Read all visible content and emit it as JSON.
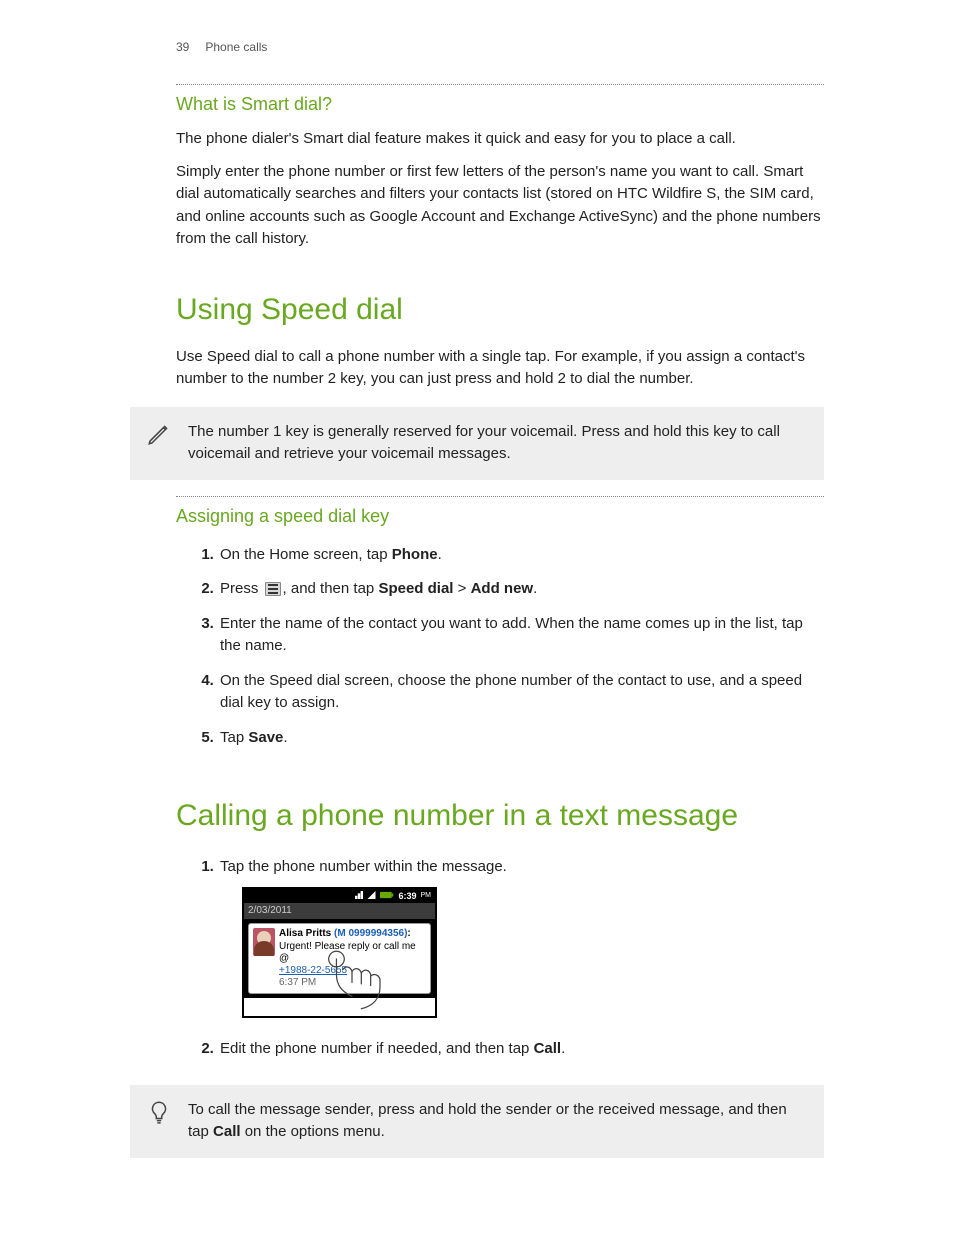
{
  "header": {
    "pageNumber": "39",
    "section": "Phone calls"
  },
  "smartDial": {
    "title": "What is Smart dial?",
    "p1": "The phone dialer's Smart dial feature makes it quick and easy for you to place a call.",
    "p2": "Simply enter the phone number or first few letters of the person's name you want to call. Smart dial automatically searches and filters your contacts list (stored on HTC Wildfire S, the SIM card, and online accounts such as Google Account and Exchange ActiveSync) and the phone numbers from the call history."
  },
  "speedDial": {
    "title": "Using Speed dial",
    "intro": "Use Speed dial to call a phone number with a single tap. For example, if you assign a contact's number to the number 2 key, you can just press and hold 2 to dial the number.",
    "note": "The number 1 key is generally reserved for your voicemail. Press and hold this key to call voicemail and retrieve your voicemail messages.",
    "assignTitle": "Assigning a speed dial key",
    "steps": {
      "s1a": "On the Home screen, tap ",
      "s1b": "Phone",
      "s1c": ".",
      "s2a": "Press ",
      "s2b": ", and then tap ",
      "s2c": "Speed dial",
      "s2d": " > ",
      "s2e": "Add new",
      "s2f": ".",
      "s3": "Enter the name of the contact you want to add. When the name comes up in the list, tap the name.",
      "s4": "On the Speed dial screen, choose the phone number of the contact to use, and a speed dial key to assign.",
      "s5a": "Tap ",
      "s5b": "Save",
      "s5c": "."
    }
  },
  "callText": {
    "title": "Calling a phone number in a text message",
    "s1": "Tap the phone number within the message.",
    "s2a": "Edit the phone number if needed, and then tap ",
    "s2b": "Call",
    "s2c": ".",
    "tip_a": "To call the message sender, press and hold the sender or the received message, and then tap ",
    "tip_b": "Call",
    "tip_c": " on the options menu."
  },
  "screenshot": {
    "time": "6:39",
    "ampm": "PM",
    "date": "2/03/2011",
    "senderName": "Alisa Pritts",
    "senderNum": "(M 0999994356)",
    "body": "Urgent! Please reply or call me @",
    "link": "+1988-22-5655",
    "msgTime": "6:37 PM"
  }
}
